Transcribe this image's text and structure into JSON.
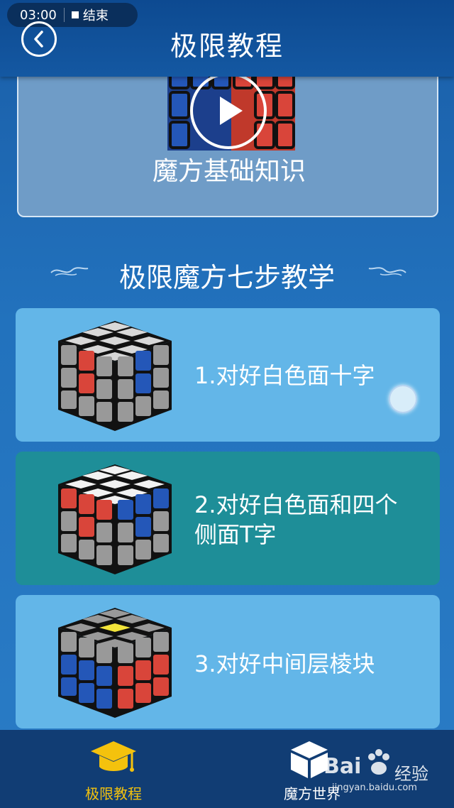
{
  "status_bar": {
    "time": "03:00",
    "end_label": "结束"
  },
  "header": {
    "title": "极限教程"
  },
  "intro_card": {
    "label": "魔方基础知识"
  },
  "section": {
    "title": "极限魔方七步教学"
  },
  "steps": [
    {
      "label": "1.对好白色面十字"
    },
    {
      "label": "2.对好白色面和四个侧面T字"
    },
    {
      "label": "3.对好中间层棱块"
    }
  ],
  "bottom_nav": {
    "items": [
      {
        "label": "极限教程",
        "active": true,
        "icon": "graduation-cap-icon",
        "color": "#f4c20d"
      },
      {
        "label": "魔方世界",
        "active": false,
        "icon": "cube-icon",
        "color": "#ffffff"
      }
    ]
  },
  "watermark": {
    "main": "Bai",
    "side": "经验",
    "sub": "jingyan.baidu.com"
  },
  "colors": {
    "header_bg": "#0d4a91",
    "page_bg": "#2272bd",
    "card_light": "#63b6e8",
    "card_teal": "#1e8e98",
    "accent_gold": "#f4c20d"
  }
}
